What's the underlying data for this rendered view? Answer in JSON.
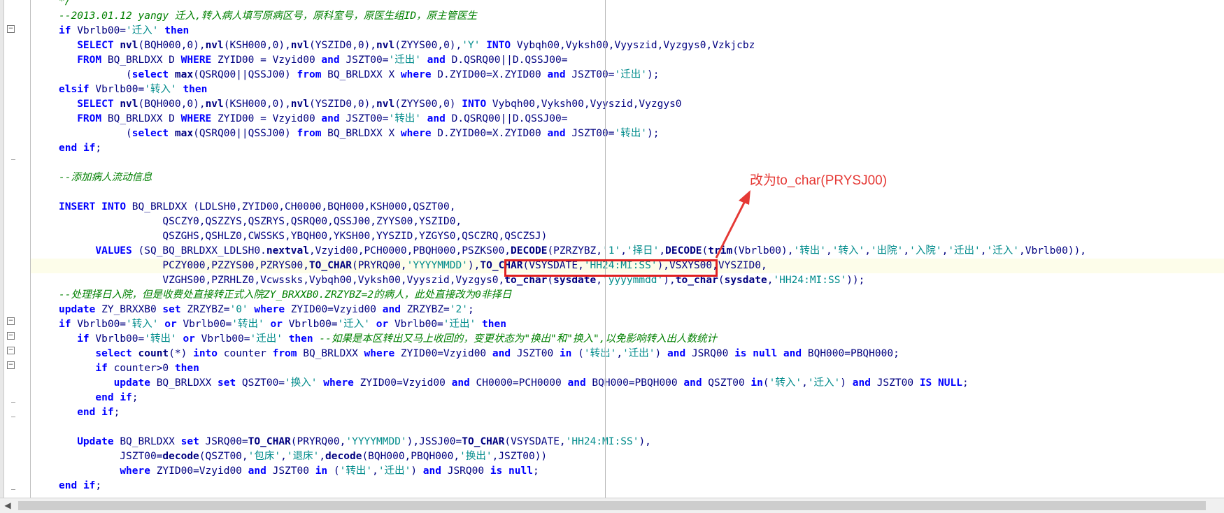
{
  "editor": {
    "lines": [
      [
        [
          "*/",
          "c"
        ]
      ],
      [
        [
          "--2013.01.12 yangy 迁入,转入病人填写原病区号，原科室号，原医生组ID，原主管医生",
          "c"
        ]
      ],
      [
        [
          "if",
          "k"
        ],
        [
          " Vbrlb00=",
          ""
        ],
        [
          "'迁入'",
          "s"
        ],
        [
          " ",
          ""
        ],
        [
          "then",
          "k"
        ]
      ],
      [
        [
          "   ",
          ""
        ],
        [
          "SELECT",
          "k"
        ],
        [
          " ",
          ""
        ],
        [
          "nvl",
          "f"
        ],
        [
          "(BQH000,0),",
          ""
        ],
        [
          "nvl",
          "f"
        ],
        [
          "(KSH000,0),",
          ""
        ],
        [
          "nvl",
          "f"
        ],
        [
          "(YSZID0,0),",
          ""
        ],
        [
          "nvl",
          "f"
        ],
        [
          "(ZYYS00,0),",
          ""
        ],
        [
          "'Y'",
          "s"
        ],
        [
          " ",
          ""
        ],
        [
          "INTO",
          "k"
        ],
        [
          " Vybqh00,Vyksh00,Vyyszid,Vyzgys0,Vzkjcbz",
          ""
        ]
      ],
      [
        [
          "   ",
          ""
        ],
        [
          "FROM",
          "k"
        ],
        [
          " BQ_BRLDXX D ",
          ""
        ],
        [
          "WHERE",
          "k"
        ],
        [
          " ZYID00 = Vzyid00 ",
          ""
        ],
        [
          "and",
          "k"
        ],
        [
          " JSZT00=",
          ""
        ],
        [
          "'迁出'",
          "s"
        ],
        [
          " ",
          ""
        ],
        [
          "and",
          "k"
        ],
        [
          " D.QSRQ00||D.QSSJ00=",
          ""
        ]
      ],
      [
        [
          "           (",
          ""
        ],
        [
          "select",
          "k"
        ],
        [
          " ",
          ""
        ],
        [
          "max",
          "f"
        ],
        [
          "(QSRQ00||QSSJ00) ",
          ""
        ],
        [
          "from",
          "k"
        ],
        [
          " BQ_BRLDXX X ",
          ""
        ],
        [
          "where",
          "k"
        ],
        [
          " D.ZYID00=X.ZYID00 ",
          ""
        ],
        [
          "and",
          "k"
        ],
        [
          " JSZT00=",
          ""
        ],
        [
          "'迁出'",
          "s"
        ],
        [
          ");",
          ""
        ]
      ],
      [
        [
          "elsif",
          "k"
        ],
        [
          " Vbrlb00=",
          ""
        ],
        [
          "'转入'",
          "s"
        ],
        [
          " ",
          ""
        ],
        [
          "then",
          "k"
        ]
      ],
      [
        [
          "   ",
          ""
        ],
        [
          "SELECT",
          "k"
        ],
        [
          " ",
          ""
        ],
        [
          "nvl",
          "f"
        ],
        [
          "(BQH000,0),",
          ""
        ],
        [
          "nvl",
          "f"
        ],
        [
          "(KSH000,0),",
          ""
        ],
        [
          "nvl",
          "f"
        ],
        [
          "(YSZID0,0),",
          ""
        ],
        [
          "nvl",
          "f"
        ],
        [
          "(ZYYS00,0) ",
          ""
        ],
        [
          "INTO",
          "k"
        ],
        [
          " Vybqh00,Vyksh00,Vyyszid,Vyzgys0",
          ""
        ]
      ],
      [
        [
          "   ",
          ""
        ],
        [
          "FROM",
          "k"
        ],
        [
          " BQ_BRLDXX D ",
          ""
        ],
        [
          "WHERE",
          "k"
        ],
        [
          " ZYID00 = Vzyid00 ",
          ""
        ],
        [
          "and",
          "k"
        ],
        [
          " JSZT00=",
          ""
        ],
        [
          "'转出'",
          "s"
        ],
        [
          " ",
          ""
        ],
        [
          "and",
          "k"
        ],
        [
          " D.QSRQ00||D.QSSJ00=",
          ""
        ]
      ],
      [
        [
          "           (",
          ""
        ],
        [
          "select",
          "k"
        ],
        [
          " ",
          ""
        ],
        [
          "max",
          "f"
        ],
        [
          "(QSRQ00||QSSJ00) ",
          ""
        ],
        [
          "from",
          "k"
        ],
        [
          " BQ_BRLDXX X ",
          ""
        ],
        [
          "where",
          "k"
        ],
        [
          " D.ZYID00=X.ZYID00 ",
          ""
        ],
        [
          "and",
          "k"
        ],
        [
          " JSZT00=",
          ""
        ],
        [
          "'转出'",
          "s"
        ],
        [
          ");",
          ""
        ]
      ],
      [
        [
          "end",
          "k"
        ],
        [
          " ",
          ""
        ],
        [
          "if",
          "k"
        ],
        [
          ";",
          ""
        ]
      ],
      [],
      [
        [
          "--添加病人流动信息",
          "c"
        ]
      ],
      [],
      [
        [
          "INSERT",
          "k"
        ],
        [
          " ",
          ""
        ],
        [
          "INTO",
          "k"
        ],
        [
          " BQ_BRLDXX (LDLSH0,ZYID00,CH0000,BQH000,KSH000,QSZT00,",
          ""
        ]
      ],
      [
        [
          "                 QSCZY0,QSZZYS,QSZRYS,QSRQ00,QSSJ00,ZYYS00,YSZID0,",
          ""
        ]
      ],
      [
        [
          "                 QSZGHS,QSHLZ0,CWSSKS,YBQH00,YKSH00,YYSZID,YZGYS0,QSCZRQ,QSCZSJ)",
          ""
        ]
      ],
      [
        [
          "      ",
          ""
        ],
        [
          "VALUES",
          "k"
        ],
        [
          " (SQ_BQ_BRLDXX_LDLSH0.",
          ""
        ],
        [
          "nextval",
          "f"
        ],
        [
          ",Vzyid00,PCH0000,PBQH000,PSZKS00,",
          ""
        ],
        [
          "DECODE",
          "f"
        ],
        [
          "(PZRZYBZ,",
          ""
        ],
        [
          "'1'",
          "s"
        ],
        [
          ",",
          ""
        ],
        [
          "'择日'",
          "s"
        ],
        [
          ",",
          ""
        ],
        [
          "DECODE",
          "f"
        ],
        [
          "(",
          ""
        ],
        [
          "trim",
          "f"
        ],
        [
          "(Vbrlb00),",
          ""
        ],
        [
          "'转出'",
          "s"
        ],
        [
          ",",
          ""
        ],
        [
          "'转入'",
          "s"
        ],
        [
          ",",
          ""
        ],
        [
          "'出院'",
          "s"
        ],
        [
          ",",
          ""
        ],
        [
          "'入院'",
          "s"
        ],
        [
          ",",
          ""
        ],
        [
          "'迁出'",
          "s"
        ],
        [
          ",",
          ""
        ],
        [
          "'迁入'",
          "s"
        ],
        [
          ",Vbrlb00)),",
          ""
        ]
      ],
      [
        [
          "                 PCZY000,PZZYS00,PZRYS00,",
          ""
        ],
        [
          "TO_CHAR",
          "f"
        ],
        [
          "(PRYRQ00,",
          ""
        ],
        [
          "'YYYYMMDD'",
          "s"
        ],
        [
          "),",
          ""
        ],
        [
          "TO_CHAR",
          "f"
        ],
        [
          "(VSYSDATE,",
          ""
        ],
        [
          "'HH24:MI:SS'",
          "s"
        ],
        [
          "),VSXYS00,VYSZID0,",
          ""
        ]
      ],
      [
        [
          "                 VZGHS00,PZRHLZ0,Vcwssks,Vybqh00,Vyksh00,Vyyszid,Vyzgys0,",
          ""
        ],
        [
          "to_char",
          "f"
        ],
        [
          "(",
          ""
        ],
        [
          "sysdate",
          "f"
        ],
        [
          ",",
          ""
        ],
        [
          "'yyyymmdd'",
          "s"
        ],
        [
          "),",
          ""
        ],
        [
          "to_char",
          "f"
        ],
        [
          "(",
          ""
        ],
        [
          "sysdate",
          "f"
        ],
        [
          ",",
          ""
        ],
        [
          "'HH24:MI:SS'",
          "s"
        ],
        [
          "));",
          ""
        ]
      ],
      [
        [
          "--处理择日入院，但是收费处直接转正式入院ZY_BRXXB0.ZRZYBZ=2的病人，此处直接改为0非择日",
          "c"
        ]
      ],
      [
        [
          "update",
          "k"
        ],
        [
          " ZY_BRXXB0 ",
          ""
        ],
        [
          "set",
          "k"
        ],
        [
          " ZRZYBZ=",
          ""
        ],
        [
          "'0'",
          "s"
        ],
        [
          " ",
          ""
        ],
        [
          "where",
          "k"
        ],
        [
          " ZYID00=Vzyid00 ",
          ""
        ],
        [
          "and",
          "k"
        ],
        [
          " ZRZYBZ=",
          ""
        ],
        [
          "'2'",
          "s"
        ],
        [
          ";",
          ""
        ]
      ],
      [
        [
          "if",
          "k"
        ],
        [
          " Vbrlb00=",
          ""
        ],
        [
          "'转入'",
          "s"
        ],
        [
          " ",
          ""
        ],
        [
          "or",
          "k"
        ],
        [
          " Vbrlb00=",
          ""
        ],
        [
          "'转出'",
          "s"
        ],
        [
          " ",
          ""
        ],
        [
          "or",
          "k"
        ],
        [
          " Vbrlb00=",
          ""
        ],
        [
          "'迁入'",
          "s"
        ],
        [
          " ",
          ""
        ],
        [
          "or",
          "k"
        ],
        [
          " Vbrlb00=",
          ""
        ],
        [
          "'迁出'",
          "s"
        ],
        [
          " ",
          ""
        ],
        [
          "then",
          "k"
        ]
      ],
      [
        [
          "   ",
          ""
        ],
        [
          "if",
          "k"
        ],
        [
          " Vbrlb00=",
          ""
        ],
        [
          "'转出'",
          "s"
        ],
        [
          " ",
          ""
        ],
        [
          "or",
          "k"
        ],
        [
          " Vbrlb00=",
          ""
        ],
        [
          "'迁出'",
          "s"
        ],
        [
          " ",
          ""
        ],
        [
          "then",
          "k"
        ],
        [
          " ",
          ""
        ],
        [
          "--如果是本区转出又马上收回的，变更状态为\"换出\"和\"换入\",以免影响转入出人数统计",
          "c"
        ]
      ],
      [
        [
          "      ",
          ""
        ],
        [
          "select",
          "k"
        ],
        [
          " ",
          ""
        ],
        [
          "count",
          "f"
        ],
        [
          "(*) ",
          ""
        ],
        [
          "into",
          "k"
        ],
        [
          " counter ",
          ""
        ],
        [
          "from",
          "k"
        ],
        [
          " BQ_BRLDXX ",
          ""
        ],
        [
          "where",
          "k"
        ],
        [
          " ZYID00=Vzyid00 ",
          ""
        ],
        [
          "and",
          "k"
        ],
        [
          " JSZT00 ",
          ""
        ],
        [
          "in",
          "k"
        ],
        [
          " (",
          ""
        ],
        [
          "'转出'",
          "s"
        ],
        [
          ",",
          ""
        ],
        [
          "'迁出'",
          "s"
        ],
        [
          ") ",
          ""
        ],
        [
          "and",
          "k"
        ],
        [
          " JSRQ00 ",
          ""
        ],
        [
          "is",
          "k"
        ],
        [
          " ",
          ""
        ],
        [
          "null",
          "k"
        ],
        [
          " ",
          ""
        ],
        [
          "and",
          "k"
        ],
        [
          " BQH000=PBQH000;",
          ""
        ]
      ],
      [
        [
          "      ",
          ""
        ],
        [
          "if",
          "k"
        ],
        [
          " counter>0 ",
          ""
        ],
        [
          "then",
          "k"
        ]
      ],
      [
        [
          "         ",
          ""
        ],
        [
          "update",
          "k"
        ],
        [
          " BQ_BRLDXX ",
          ""
        ],
        [
          "set",
          "k"
        ],
        [
          " QSZT00=",
          ""
        ],
        [
          "'换入'",
          "s"
        ],
        [
          " ",
          ""
        ],
        [
          "where",
          "k"
        ],
        [
          " ZYID00=Vzyid00 ",
          ""
        ],
        [
          "and",
          "k"
        ],
        [
          " CH0000=PCH0000 ",
          ""
        ],
        [
          "and",
          "k"
        ],
        [
          " BQH000=PBQH000 ",
          ""
        ],
        [
          "and",
          "k"
        ],
        [
          " QSZT00 ",
          ""
        ],
        [
          "in",
          "k"
        ],
        [
          "(",
          ""
        ],
        [
          "'转入'",
          "s"
        ],
        [
          ",",
          ""
        ],
        [
          "'迁入'",
          "s"
        ],
        [
          ") ",
          ""
        ],
        [
          "and",
          "k"
        ],
        [
          " JSZT00 ",
          ""
        ],
        [
          "IS",
          "k"
        ],
        [
          " ",
          ""
        ],
        [
          "NULL",
          "k"
        ],
        [
          ";",
          ""
        ]
      ],
      [
        [
          "      ",
          ""
        ],
        [
          "end",
          "k"
        ],
        [
          " ",
          ""
        ],
        [
          "if",
          "k"
        ],
        [
          ";",
          ""
        ]
      ],
      [
        [
          "   ",
          ""
        ],
        [
          "end",
          "k"
        ],
        [
          " ",
          ""
        ],
        [
          "if",
          "k"
        ],
        [
          ";",
          ""
        ]
      ],
      [],
      [
        [
          "   ",
          ""
        ],
        [
          "Update",
          "k"
        ],
        [
          " BQ_BRLDXX ",
          ""
        ],
        [
          "set",
          "k"
        ],
        [
          " JSRQ00=",
          ""
        ],
        [
          "TO_CHAR",
          "f"
        ],
        [
          "(PRYRQ00,",
          ""
        ],
        [
          "'YYYYMMDD'",
          "s"
        ],
        [
          "),JSSJ00=",
          ""
        ],
        [
          "TO_CHAR",
          "f"
        ],
        [
          "(VSYSDATE,",
          ""
        ],
        [
          "'HH24:MI:SS'",
          "s"
        ],
        [
          "),",
          ""
        ]
      ],
      [
        [
          "          JSZT00=",
          ""
        ],
        [
          "decode",
          "f"
        ],
        [
          "(QSZT00,",
          ""
        ],
        [
          "'包床'",
          "s"
        ],
        [
          ",",
          ""
        ],
        [
          "'退床'",
          "s"
        ],
        [
          ",",
          ""
        ],
        [
          "decode",
          "f"
        ],
        [
          "(BQH000,PBQH000,",
          ""
        ],
        [
          "'换出'",
          "s"
        ],
        [
          ",JSZT00))",
          ""
        ]
      ],
      [
        [
          "          ",
          ""
        ],
        [
          "where",
          "k"
        ],
        [
          " ZYID00=Vzyid00 ",
          ""
        ],
        [
          "and",
          "k"
        ],
        [
          " JSZT00 ",
          ""
        ],
        [
          "in",
          "k"
        ],
        [
          " (",
          ""
        ],
        [
          "'转出'",
          "s"
        ],
        [
          ",",
          ""
        ],
        [
          "'迁出'",
          "s"
        ],
        [
          ") ",
          ""
        ],
        [
          "and",
          "k"
        ],
        [
          " JSRQ00 ",
          ""
        ],
        [
          "is",
          "k"
        ],
        [
          " ",
          ""
        ],
        [
          "null",
          "k"
        ],
        [
          ";",
          ""
        ]
      ],
      [
        [
          "end",
          "k"
        ],
        [
          " ",
          ""
        ],
        [
          "if",
          "k"
        ],
        [
          ";",
          ""
        ]
      ]
    ],
    "current_line_index": 18
  },
  "annotation": {
    "text": "改为to_char(PRYSJ00)",
    "color": "#e53935"
  },
  "colors": {
    "keyword": "#0000ff",
    "string": "#008b8b",
    "comment": "#008000",
    "identifier": "#000080",
    "highlight_box": "#e02020"
  }
}
